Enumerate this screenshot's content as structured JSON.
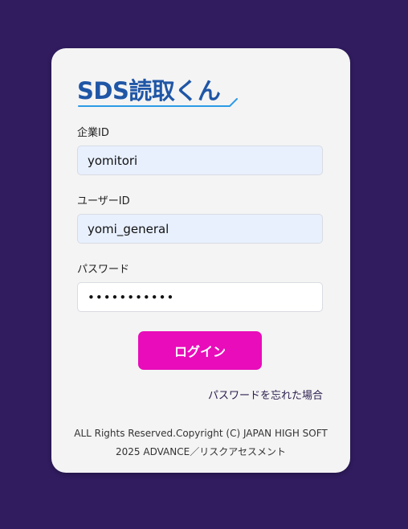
{
  "app": {
    "logo_text": "SDS読取くん"
  },
  "colors": {
    "page_background": "#301c5f",
    "card_background": "#f4f4f4",
    "logo_text": "#1f56a6",
    "logo_underline": "#2b9be8",
    "login_button": "#e80cba",
    "autofill_field": "#e8f0fe"
  },
  "form": {
    "company_id": {
      "label": "企業ID",
      "value": "yomitori"
    },
    "user_id": {
      "label": "ユーザーID",
      "value": "yomi_general"
    },
    "password": {
      "label": "パスワード",
      "value": "•••••••••••"
    },
    "login_label": "ログイン",
    "forgot_password_label": "パスワードを忘れた場合"
  },
  "footer": {
    "line1": "ALL Rights Reserved.Copyright (C) JAPAN HIGH SOFT",
    "line2": "2025 ADVANCE／リスクアセスメント"
  }
}
